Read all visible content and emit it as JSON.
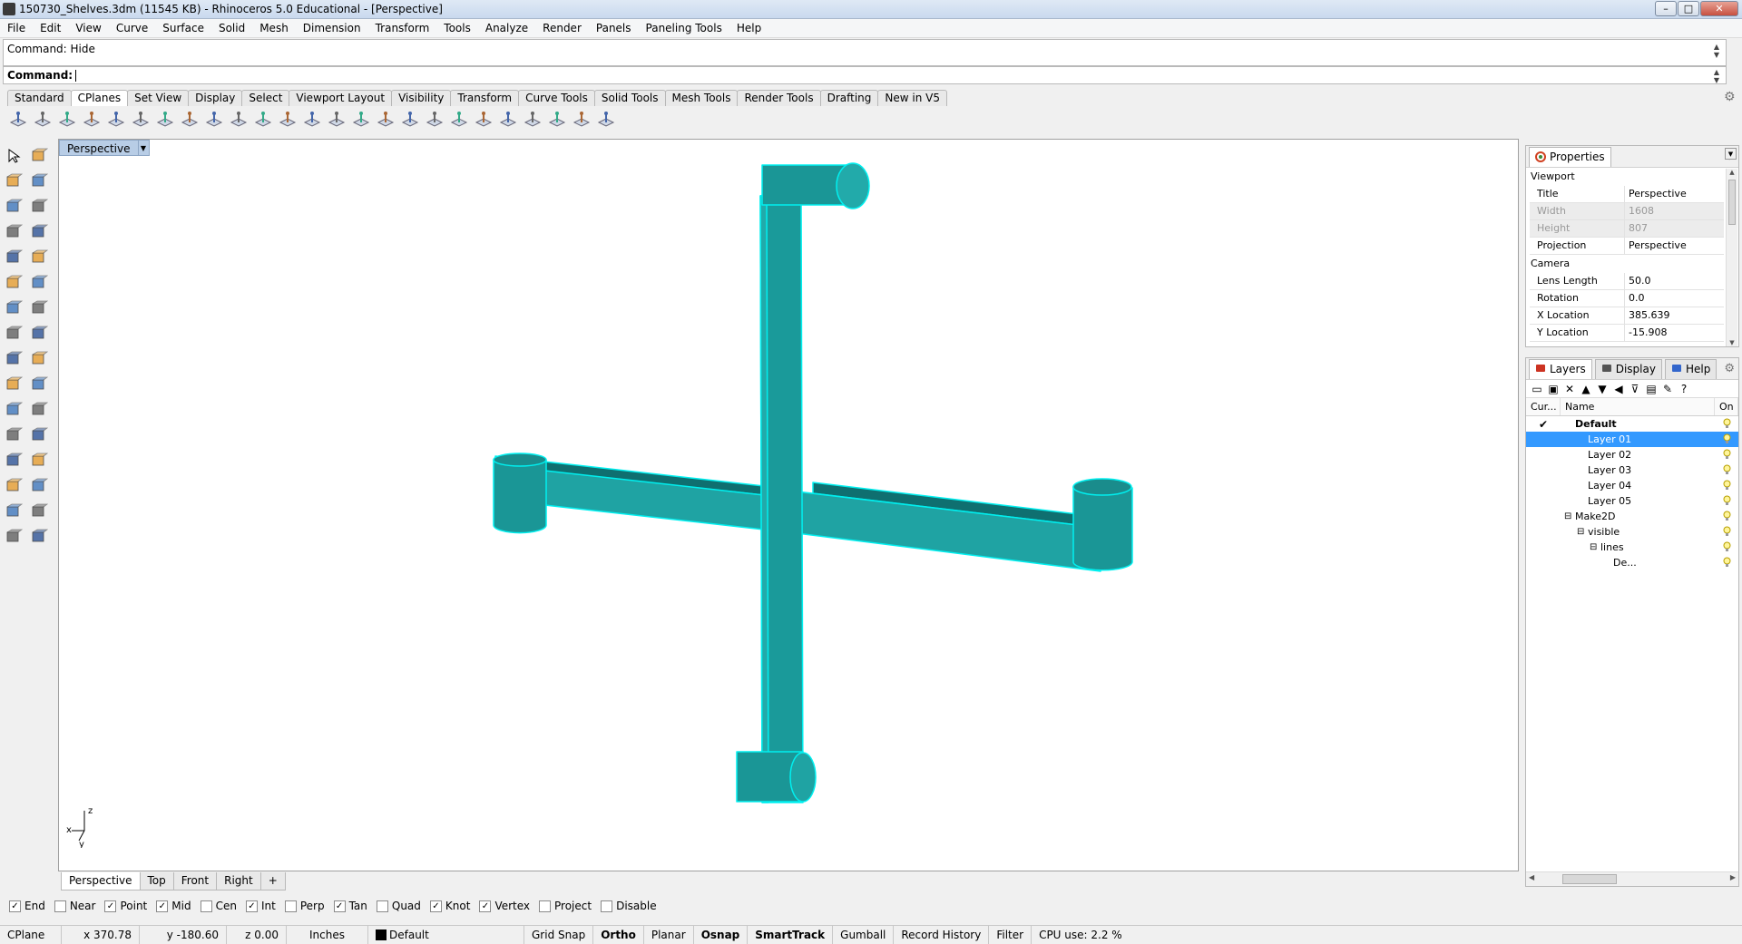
{
  "window": {
    "title": "150730_Shelves.3dm (11545 KB) - Rhinoceros 5.0 Educational - [Perspective]",
    "controls": {
      "minimize": "–",
      "maximize": "□",
      "close": "✕"
    }
  },
  "menu": [
    "File",
    "Edit",
    "View",
    "Curve",
    "Surface",
    "Solid",
    "Mesh",
    "Dimension",
    "Transform",
    "Tools",
    "Analyze",
    "Render",
    "Panels",
    "Paneling Tools",
    "Help"
  ],
  "command": {
    "history": "Command: Hide",
    "prompt_label": "Command:",
    "value": ""
  },
  "toolbar_tabs": [
    "Standard",
    "CPlanes",
    "Set View",
    "Display",
    "Select",
    "Viewport Layout",
    "Visibility",
    "Transform",
    "Curve Tools",
    "Solid Tools",
    "Mesh Tools",
    "Render Tools",
    "Drafting",
    "New in V5"
  ],
  "toolbar_active_tab": "CPlanes",
  "viewport": {
    "name": "Perspective",
    "axes": {
      "z": "z",
      "x": "x",
      "y": "y"
    }
  },
  "viewport_tabs": [
    "Perspective",
    "Top",
    "Front",
    "Right",
    "+"
  ],
  "osnaps": [
    {
      "label": "End",
      "checked": true
    },
    {
      "label": "Near",
      "checked": false
    },
    {
      "label": "Point",
      "checked": true
    },
    {
      "label": "Mid",
      "checked": true
    },
    {
      "label": "Cen",
      "checked": false
    },
    {
      "label": "Int",
      "checked": true
    },
    {
      "label": "Perp",
      "checked": false
    },
    {
      "label": "Tan",
      "checked": true
    },
    {
      "label": "Quad",
      "checked": false
    },
    {
      "label": "Knot",
      "checked": true
    },
    {
      "label": "Vertex",
      "checked": true
    },
    {
      "label": "Project",
      "checked": false
    },
    {
      "label": "Disable",
      "checked": false
    }
  ],
  "status": {
    "cplane": "CPlane",
    "x": "x 370.78",
    "y": "y -180.60",
    "z": "z 0.00",
    "units": "Inches",
    "layer": "Default",
    "grid_snap": "Grid Snap",
    "ortho": "Ortho",
    "planar": "Planar",
    "osnap": "Osnap",
    "smarttrack": "SmartTrack",
    "gumball": "Gumball",
    "record_history": "Record History",
    "filter": "Filter",
    "cpu": "CPU use: 2.2 %"
  },
  "properties": {
    "tab": "Properties",
    "section_viewport": "Viewport",
    "rows_viewport": [
      {
        "k": "Title",
        "v": "Perspective",
        "grey": false
      },
      {
        "k": "Width",
        "v": "1608",
        "grey": true
      },
      {
        "k": "Height",
        "v": "807",
        "grey": true
      },
      {
        "k": "Projection",
        "v": "Perspective",
        "grey": false
      }
    ],
    "section_camera": "Camera",
    "rows_camera": [
      {
        "k": "Lens Length",
        "v": "50.0"
      },
      {
        "k": "Rotation",
        "v": "0.0"
      },
      {
        "k": "X Location",
        "v": "385.639"
      },
      {
        "k": "Y Location",
        "v": "-15.908"
      }
    ]
  },
  "layers_panel": {
    "tabs": [
      "Layers",
      "Display",
      "Help"
    ],
    "headers": {
      "current": "Cur...",
      "name": "Name",
      "on": "On"
    },
    "rows": [
      {
        "name": "Default",
        "indent": 0,
        "current": true,
        "selected": false,
        "bold": true,
        "expander": ""
      },
      {
        "name": "Layer 01",
        "indent": 1,
        "current": false,
        "selected": true,
        "bold": false,
        "expander": ""
      },
      {
        "name": "Layer 02",
        "indent": 1,
        "current": false,
        "selected": false,
        "bold": false,
        "expander": ""
      },
      {
        "name": "Layer 03",
        "indent": 1,
        "current": false,
        "selected": false,
        "bold": false,
        "expander": ""
      },
      {
        "name": "Layer 04",
        "indent": 1,
        "current": false,
        "selected": false,
        "bold": false,
        "expander": ""
      },
      {
        "name": "Layer 05",
        "indent": 1,
        "current": false,
        "selected": false,
        "bold": false,
        "expander": ""
      },
      {
        "name": "Make2D",
        "indent": 0,
        "current": false,
        "selected": false,
        "bold": false,
        "expander": "⊟"
      },
      {
        "name": "visible",
        "indent": 1,
        "current": false,
        "selected": false,
        "bold": false,
        "expander": "⊟"
      },
      {
        "name": "lines",
        "indent": 2,
        "current": false,
        "selected": false,
        "bold": false,
        "expander": "⊟"
      },
      {
        "name": "De...",
        "indent": 3,
        "current": false,
        "selected": false,
        "bold": false,
        "expander": ""
      }
    ]
  },
  "colors": {
    "model_fill": "#1fa3a3",
    "model_edge": "#00f0f0",
    "selection": "#3399ff"
  }
}
